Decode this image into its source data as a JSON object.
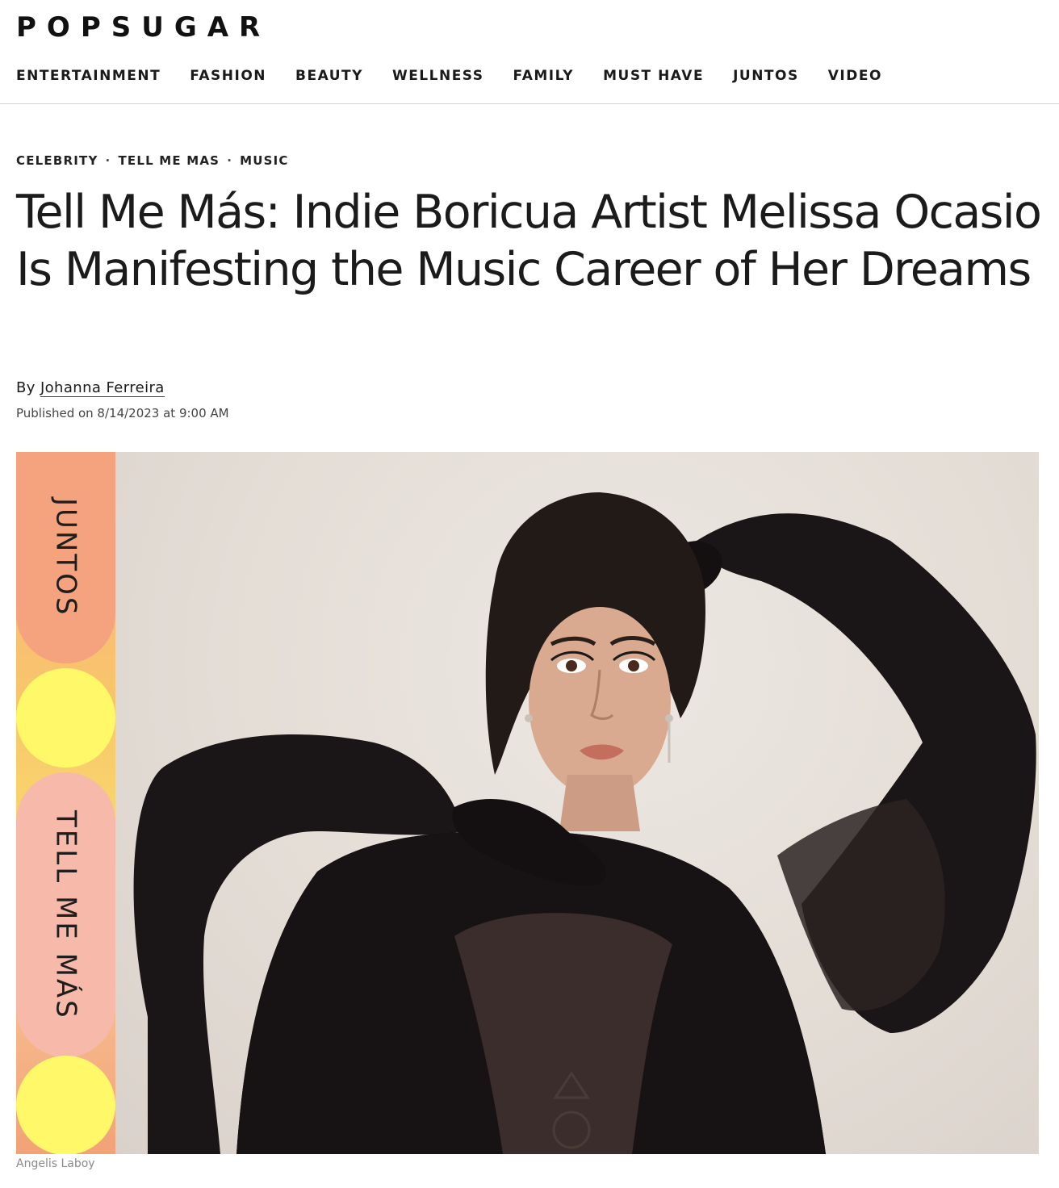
{
  "site": {
    "logo": "POPSUGAR"
  },
  "nav": {
    "items": [
      "ENTERTAINMENT",
      "FASHION",
      "BEAUTY",
      "WELLNESS",
      "FAMILY",
      "MUST HAVE",
      "JUNTOS",
      "VIDEO"
    ]
  },
  "article": {
    "breadcrumbs": [
      "CELEBRITY",
      "TELL ME MAS",
      "MUSIC"
    ],
    "breadcrumb_separator": "·",
    "headline": "Tell Me Más: Indie Boricua Artist Melissa Ocasio Is Manifesting the Music Career of Her Dreams",
    "byline_prefix": "By",
    "author": "Johanna Ferreira",
    "published": "Published on 8/14/2023 at 9:00 AM"
  },
  "hero": {
    "strip_labels": {
      "top": "JUNTOS",
      "middle": "TELL ME MÁS"
    },
    "caption": "Angelis Laboy"
  }
}
